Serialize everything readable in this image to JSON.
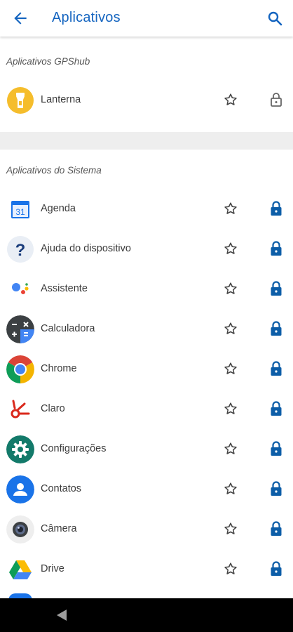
{
  "appbar": {
    "title": "Aplicativos"
  },
  "sections": {
    "gpshub": {
      "title": "Aplicativos GPShub"
    },
    "system": {
      "title": "Aplicativos do Sistema"
    }
  },
  "gpshub_apps": [
    {
      "label": "Lanterna",
      "icon": "flashlight-icon",
      "locked": false
    }
  ],
  "system_apps": [
    {
      "label": "Agenda",
      "icon": "calendar-icon",
      "locked": true
    },
    {
      "label": "Ajuda do dispositivo",
      "icon": "help-icon",
      "locked": true
    },
    {
      "label": "Assistente",
      "icon": "assistant-icon",
      "locked": true
    },
    {
      "label": "Calculadora",
      "icon": "calculator-icon",
      "locked": true
    },
    {
      "label": "Chrome",
      "icon": "chrome-icon",
      "locked": true
    },
    {
      "label": "Claro",
      "icon": "claro-icon",
      "locked": true
    },
    {
      "label": "Configurações",
      "icon": "settings-icon",
      "locked": true
    },
    {
      "label": "Contatos",
      "icon": "contacts-icon",
      "locked": true
    },
    {
      "label": "Câmera",
      "icon": "camera-icon",
      "locked": true
    },
    {
      "label": "Drive",
      "icon": "drive-icon",
      "locked": true
    }
  ],
  "colors": {
    "accent": "#1565c0",
    "lock_blue": "#0d5ea8",
    "section_band": "#eeeeee"
  }
}
